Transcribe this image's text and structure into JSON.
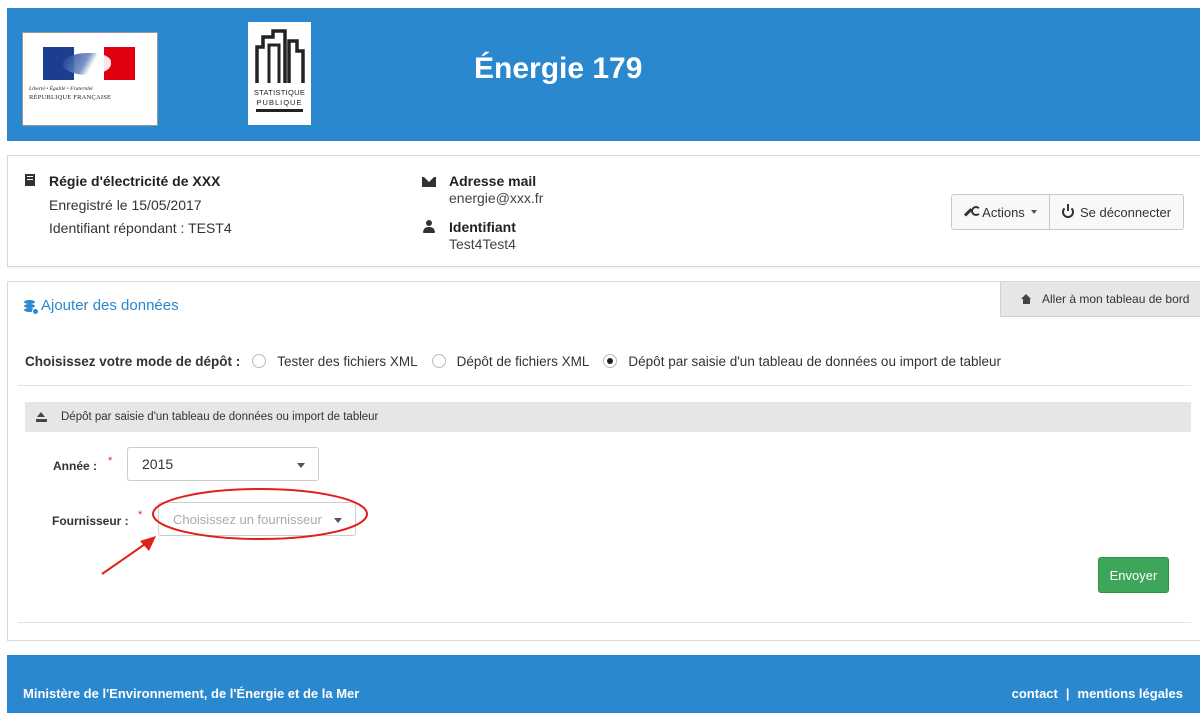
{
  "header": {
    "title": "Énergie 179",
    "logo_rf": {
      "motto": "Liberté • Égalité • Fraternité",
      "name": "RÉPUBLIQUE FRANÇAISE"
    },
    "logo_sp": {
      "line1": "STATISTIQUE",
      "line2": "PUBLIQUE"
    }
  },
  "info": {
    "org_name": "Régie d'électricité de XXX",
    "registered": "Enregistré le 15/05/2017",
    "respondent_id": "Identifiant répondant : TEST4",
    "mail_title": "Adresse mail",
    "mail_value": "energie@xxx.fr",
    "id_title": "Identifiant",
    "id_value": "Test4Test4",
    "actions_label": "Actions",
    "logout_label": "Se déconnecter"
  },
  "main": {
    "section_title": "Ajouter des données",
    "dashboard_link": "Aller à mon tableau de bord",
    "mode_label": "Choisissez votre mode de dépôt :",
    "modes": [
      {
        "label": "Tester des fichiers XML",
        "selected": false
      },
      {
        "label": "Dépôt de fichiers XML",
        "selected": false
      },
      {
        "label": "Dépôt par saisie d'un tableau de données ou import de tableur",
        "selected": true
      }
    ],
    "sub_header": "Dépôt par saisie d'un tableau de données ou import de tableur",
    "year_label": "Année :",
    "year_value": "2015",
    "supplier_label": "Fournisseur :",
    "supplier_placeholder": "Choisissez un fournisseur",
    "required_mark": "*",
    "submit_label": "Envoyer"
  },
  "footer": {
    "ministry": "Ministère de l'Environnement, de l'Énergie et de la Mer",
    "contact": "contact",
    "separator": "|",
    "legal": "mentions légales"
  },
  "colors": {
    "header_blue": "#2a88cf",
    "submit_green": "#3ea65a",
    "annotation_red": "#e0201a"
  }
}
